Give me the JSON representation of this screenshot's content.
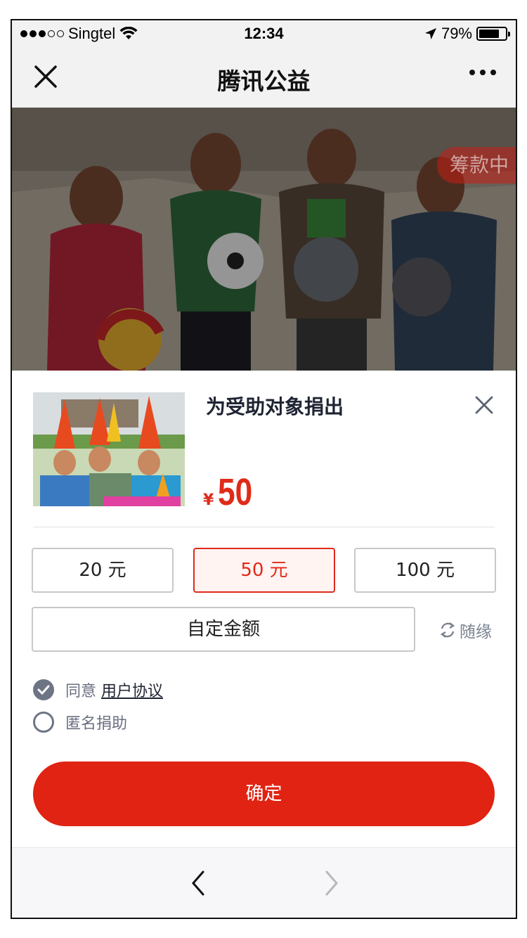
{
  "status_bar": {
    "carrier": "Singtel",
    "time": "12:34",
    "battery": "79%",
    "battery_level": 0.79,
    "signal_bars_filled": 3,
    "signal_bars_total": 5
  },
  "nav": {
    "title": "腾讯公益",
    "close_icon": "close-icon",
    "more_icon": "more-dots-icon"
  },
  "hero": {
    "badge": "筹款中"
  },
  "donation": {
    "title": "为受助对象捐出",
    "currency": "¥",
    "amount": "50",
    "options": [
      {
        "label": "20 元",
        "selected": false
      },
      {
        "label": "50 元",
        "selected": true
      },
      {
        "label": "100 元",
        "selected": false
      }
    ],
    "custom_label": "自定金额",
    "random_label": "随缘",
    "agree_prefix": "同意",
    "agreement_link": "用户协议",
    "agree_checked": true,
    "anonymous_label": "匿名捐助",
    "anonymous_checked": false,
    "confirm_label": "确定"
  },
  "colors": {
    "accent": "#e02312",
    "muted": "#6d7585"
  }
}
